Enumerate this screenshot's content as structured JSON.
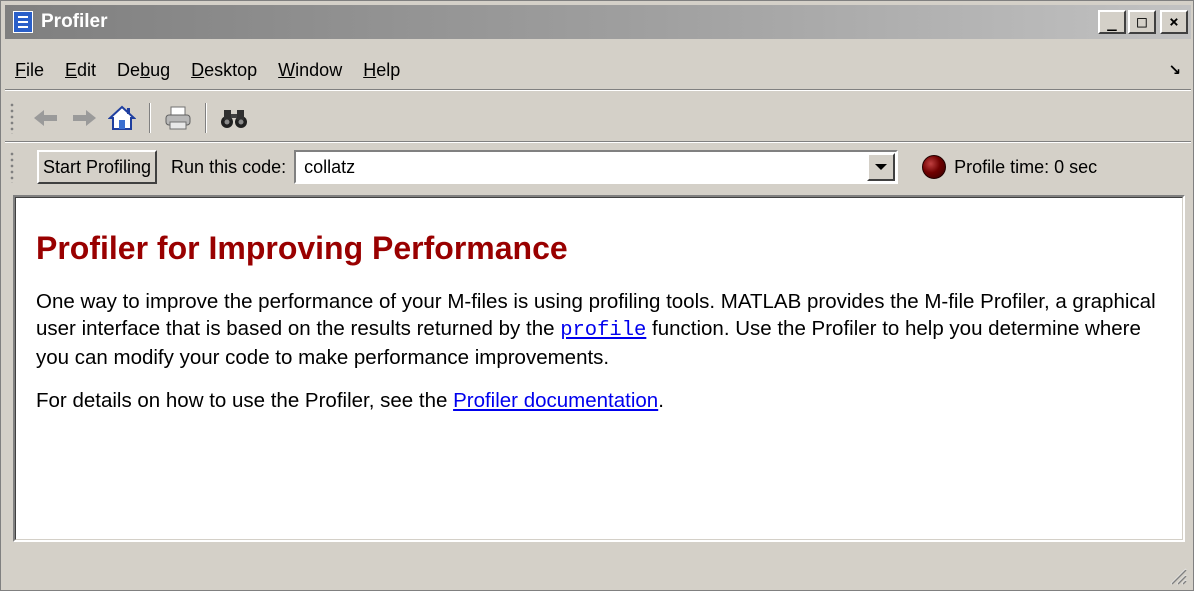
{
  "window": {
    "title": "Profiler",
    "controls": {
      "minimize": "_",
      "maximize": "□",
      "close": "×"
    }
  },
  "menubar": {
    "items": [
      {
        "pre": "",
        "u": "F",
        "post": "ile"
      },
      {
        "pre": "",
        "u": "E",
        "post": "dit"
      },
      {
        "pre": "De",
        "u": "b",
        "post": "ug"
      },
      {
        "pre": "",
        "u": "D",
        "post": "esktop"
      },
      {
        "pre": "",
        "u": "W",
        "post": "indow"
      },
      {
        "pre": "",
        "u": "H",
        "post": "elp"
      }
    ],
    "dock_icon": "↘"
  },
  "toolbar": {
    "icons": [
      "back-arrow-icon",
      "forward-arrow-icon",
      "home-icon",
      "print-icon",
      "find-binoculars-icon"
    ]
  },
  "profilebar": {
    "start_label": "Start Profiling",
    "run_label": "Run this code:",
    "code_value": "collatz",
    "profile_time": "Profile time: 0 sec",
    "indicator_color": "#6b0000"
  },
  "content": {
    "heading": "Profiler for Improving Performance",
    "para1_a": "One way to improve the performance of your M-files is using profiling tools. MATLAB provides the M-file Profiler, a graphical user interface that is based on the results returned by the ",
    "para1_link": "profile",
    "para1_b": " function. Use the Profiler to help you determine where you can modify your code to make performance improvements.",
    "para2_a": "For details on how to use the Profiler, see the ",
    "para2_link": "Profiler documentation",
    "para2_b": "."
  },
  "colors": {
    "heading": "#990000",
    "link": "#0000ee",
    "window_bg": "#d4d0c8"
  }
}
